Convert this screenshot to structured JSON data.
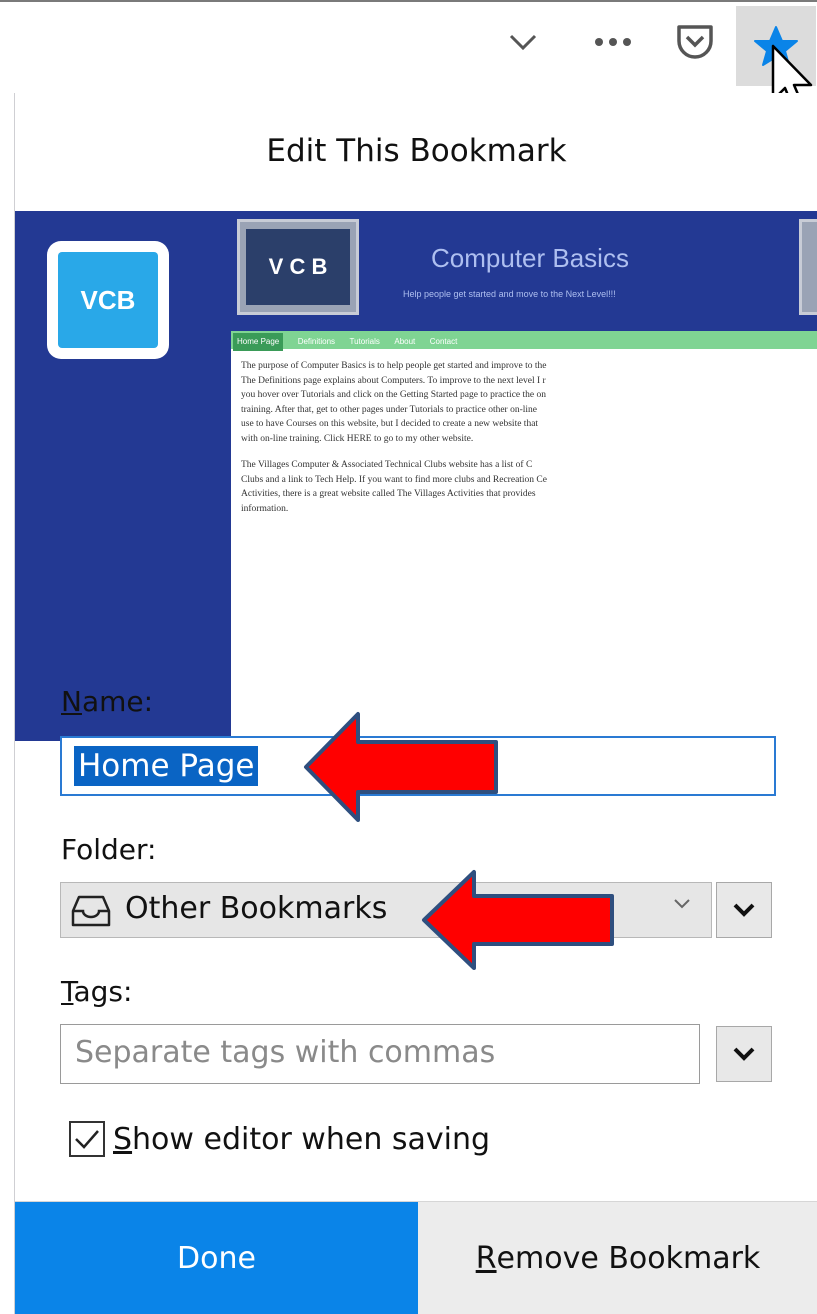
{
  "toolbar": {
    "icons": [
      "chevron-down-icon",
      "more-dots-icon",
      "pocket-icon",
      "star-bookmark-icon"
    ],
    "dots_label": "•••"
  },
  "panel": {
    "title": "Edit This Bookmark",
    "preview": {
      "logo_text": "VCB",
      "site_logo_text": "V C B",
      "site_title": "Computer Basics",
      "site_tagline": "Help people get started and move to the Next Level!!!",
      "nav": [
        "Home Page",
        "Definitions",
        "Tutorials",
        "About",
        "Contact"
      ],
      "paragraphs": [
        "The purpose of Computer Basics is to help people get started and improve to the",
        "The Definitions page explains about Computers.  To improve to the next level I r",
        "you hover over Tutorials and click on the Getting Started page to practice the on",
        "training.  After that, get to other pages under Tutorials to practice other on-line",
        "use to have Courses on this website, but I decided to create a new website that",
        "with on-line training.  Click HERE to go to my other website."
      ],
      "paragraphs2": [
        "The Villages Computer & Associated Technical Clubs website has a list of C",
        "Clubs and a link to Tech Help.  If you want to find more clubs and Recreation Ce",
        "Activities, there is a great website called The Villages Activities that provides",
        "information."
      ]
    },
    "name_label_u": "N",
    "name_label_rest": "ame:",
    "name_value": "Home Page",
    "folder_label": "Folder:",
    "folder_value": "Other Bookmarks",
    "tags_label_u": "T",
    "tags_label_rest": "ags:",
    "tags_placeholder": "Separate tags with commas",
    "show_editor_u": "S",
    "show_editor_rest": "how editor when saving",
    "show_editor_checked": true,
    "done_label": "Done",
    "remove_label_u": "R",
    "remove_label_rest": "emove Bookmark"
  },
  "colors": {
    "accent": "#0a84e8",
    "selection": "#0a64c4",
    "annotation_arrow": "#ff0000",
    "preview_bg": "#233993"
  }
}
